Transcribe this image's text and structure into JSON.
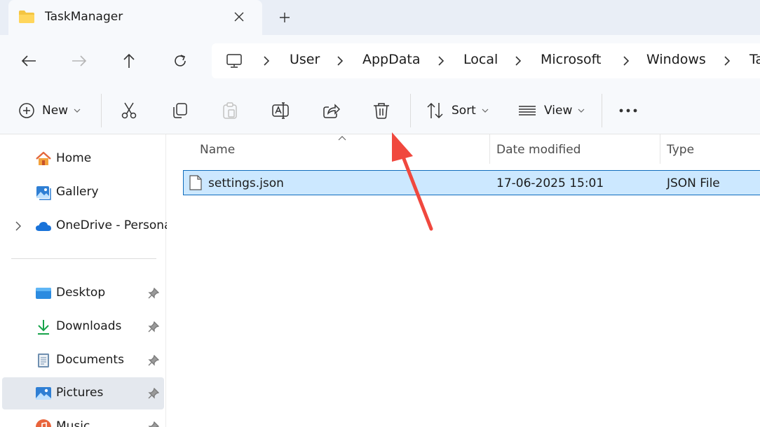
{
  "window": {
    "tab_title": "TaskManager",
    "tab_icon": "folder-icon",
    "close_icon": "close-icon",
    "new_tab_icon": "plus-icon"
  },
  "navigation": {
    "back_icon": "arrow-left-icon",
    "forward_icon": "arrow-right-icon",
    "up_icon": "arrow-up-icon",
    "refresh_icon": "refresh-icon"
  },
  "address_bar": {
    "root_icon": "this-pc-icon",
    "breadcrumbs": [
      "User",
      "AppData",
      "Local",
      "Microsoft",
      "Windows",
      "Ta"
    ]
  },
  "commands": {
    "new_label": "New",
    "sort_label": "Sort",
    "view_label": "View",
    "icons": [
      "new-icon",
      "cut-icon",
      "copy-icon",
      "paste-icon",
      "rename-icon",
      "share-icon",
      "delete-icon",
      "sort-icon",
      "view-icon",
      "more-icon"
    ]
  },
  "sidebar": {
    "items": [
      {
        "label": "Home",
        "icon": "home-icon"
      },
      {
        "label": "Gallery",
        "icon": "gallery-icon"
      },
      {
        "label": "OneDrive - Persona",
        "icon": "onedrive-icon"
      },
      {
        "label": "Desktop",
        "icon": "desktop-icon",
        "pinned": true
      },
      {
        "label": "Downloads",
        "icon": "downloads-icon",
        "pinned": true
      },
      {
        "label": "Documents",
        "icon": "documents-icon",
        "pinned": true
      },
      {
        "label": "Pictures",
        "icon": "pictures-icon",
        "pinned": true,
        "selected": true
      },
      {
        "label": "Music",
        "icon": "music-icon",
        "pinned": true
      }
    ]
  },
  "file_list": {
    "columns": [
      "Name",
      "Date modified",
      "Type"
    ],
    "rows": [
      {
        "name": "settings.json",
        "date_modified": "17-06-2025 15:01",
        "type": "JSON File",
        "selected": true
      }
    ]
  },
  "colors": {
    "accent": "#0f6cbd",
    "selection_bg": "#cce8ff",
    "annotation_arrow": "#f0483e",
    "chrome_bg": "#f7f9fc",
    "tabbar_bg": "#e9eef6"
  }
}
